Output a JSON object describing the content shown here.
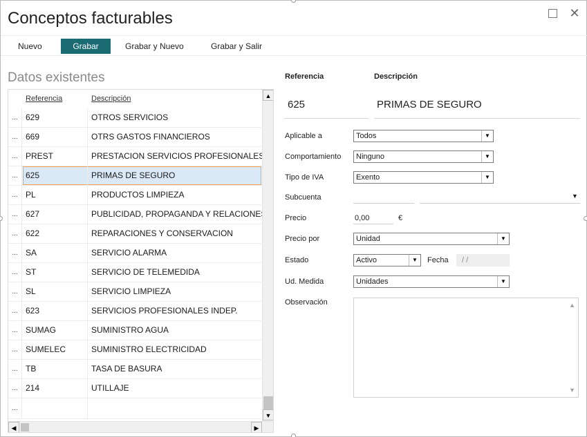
{
  "window": {
    "title": "Conceptos facturables"
  },
  "toolbar": {
    "nuevo": "Nuevo",
    "grabar": "Grabar",
    "grabar_nuevo": "Grabar y Nuevo",
    "grabar_salir": "Grabar y Salir"
  },
  "list": {
    "section_title": "Datos existentes",
    "headers": {
      "referencia": "Referencia",
      "descripcion": "Descripción"
    },
    "row_marker": "...",
    "rows": [
      {
        "ref": "629",
        "desc": "OTROS SERVICIOS"
      },
      {
        "ref": "669",
        "desc": "OTRS GASTOS FINANCIEROS"
      },
      {
        "ref": "PREST",
        "desc": "PRESTACION SERVICIOS PROFESIONALES"
      },
      {
        "ref": "625",
        "desc": "PRIMAS DE SEGURO"
      },
      {
        "ref": "PL",
        "desc": "PRODUCTOS LIMPIEZA"
      },
      {
        "ref": "627",
        "desc": "PUBLICIDAD, PROPAGANDA Y RELACIONES"
      },
      {
        "ref": "622",
        "desc": "REPARACIONES Y CONSERVACION"
      },
      {
        "ref": "SA",
        "desc": "SERVICIO ALARMA"
      },
      {
        "ref": "ST",
        "desc": "SERVICIO DE TELEMEDIDA"
      },
      {
        "ref": "SL",
        "desc": "SERVICIO LIMPIEZA"
      },
      {
        "ref": "623",
        "desc": "SERVICIOS PROFESIONALES INDEP."
      },
      {
        "ref": "SUMAG",
        "desc": "SUMINISTRO AGUA"
      },
      {
        "ref": "SUMELEC",
        "desc": "SUMINISTRO ELECTRICIDAD"
      },
      {
        "ref": "TB",
        "desc": "TASA DE BASURA"
      },
      {
        "ref": "214",
        "desc": "UTILLAJE"
      }
    ],
    "selected_ref": "625"
  },
  "form": {
    "referencia_label": "Referencia",
    "descripcion_label": "Descripción",
    "referencia_value": "625",
    "descripcion_value": "PRIMAS DE SEGURO",
    "aplicable_label": "Aplicable a",
    "aplicable_value": "Todos",
    "comportamiento_label": "Comportamiento",
    "comportamiento_value": "Ninguno",
    "iva_label": "Tipo de IVA",
    "iva_value": "Exento",
    "subcuenta_label": "Subcuenta",
    "subcuenta_value": "",
    "precio_label": "Precio",
    "precio_value": "0,00",
    "currency": "€",
    "precio_por_label": "Precio por",
    "precio_por_value": "Unidad",
    "estado_label": "Estado",
    "estado_value": "Activo",
    "fecha_label": "Fecha",
    "fecha_value": "/ /",
    "ud_medida_label": "Ud. Medida",
    "ud_medida_value": "Unidades",
    "observacion_label": "Observación",
    "observacion_value": ""
  },
  "colors": {
    "accent": "#1b6b72",
    "selected_row": "#dbe9f7",
    "selected_border": "#f0a050"
  }
}
